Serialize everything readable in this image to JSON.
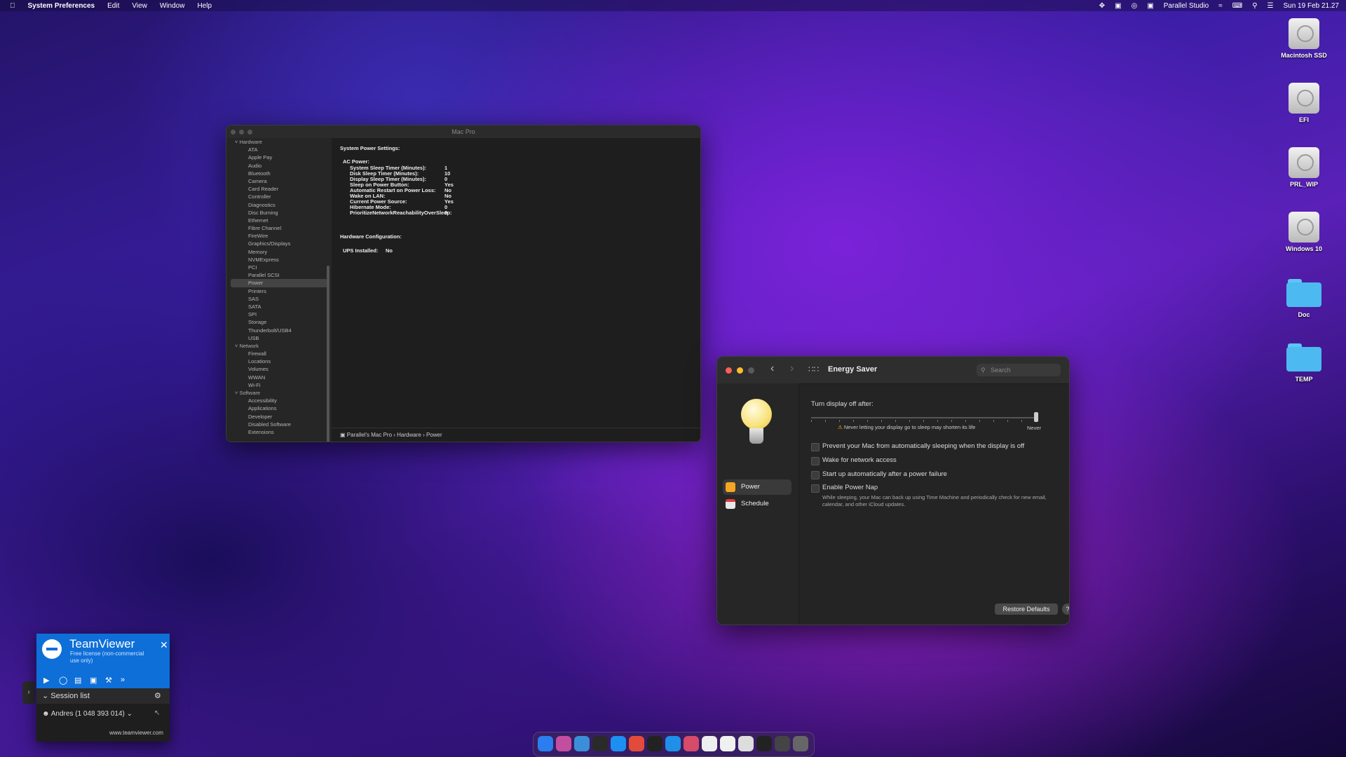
{
  "menubar": {
    "apple": "",
    "app": "System Preferences",
    "menus": [
      "Edit",
      "View",
      "Window",
      "Help"
    ],
    "user": "Parallel Studio",
    "datetime": "Sun 19 Feb  21.27"
  },
  "desktop": {
    "icons": [
      "Macintosh SSD",
      "EFI",
      "PRL_WIP",
      "Windows 10",
      "Doc",
      "TEMP"
    ]
  },
  "sysinfo": {
    "title": "Mac Pro",
    "sidebar": [
      {
        "kind": "cat",
        "label": "Hardware"
      },
      {
        "kind": "item",
        "label": "ATA"
      },
      {
        "kind": "item",
        "label": "Apple Pay"
      },
      {
        "kind": "item",
        "label": "Audio"
      },
      {
        "kind": "item",
        "label": "Bluetooth"
      },
      {
        "kind": "item",
        "label": "Camera"
      },
      {
        "kind": "item",
        "label": "Card Reader"
      },
      {
        "kind": "item",
        "label": "Controller"
      },
      {
        "kind": "item",
        "label": "Diagnostics"
      },
      {
        "kind": "item",
        "label": "Disc Burning"
      },
      {
        "kind": "item",
        "label": "Ethernet"
      },
      {
        "kind": "item",
        "label": "Fibre Channel"
      },
      {
        "kind": "item",
        "label": "FireWire"
      },
      {
        "kind": "item",
        "label": "Graphics/Displays"
      },
      {
        "kind": "item",
        "label": "Memory"
      },
      {
        "kind": "item",
        "label": "NVMExpress"
      },
      {
        "kind": "item",
        "label": "PCI"
      },
      {
        "kind": "item",
        "label": "Parallel SCSI"
      },
      {
        "kind": "item",
        "label": "Power",
        "selected": true
      },
      {
        "kind": "item",
        "label": "Printers"
      },
      {
        "kind": "item",
        "label": "SAS"
      },
      {
        "kind": "item",
        "label": "SATA"
      },
      {
        "kind": "item",
        "label": "SPI"
      },
      {
        "kind": "item",
        "label": "Storage"
      },
      {
        "kind": "item",
        "label": "Thunderbolt/USB4"
      },
      {
        "kind": "item",
        "label": "USB"
      },
      {
        "kind": "cat",
        "label": "Network"
      },
      {
        "kind": "item",
        "label": "Firewall"
      },
      {
        "kind": "item",
        "label": "Locations"
      },
      {
        "kind": "item",
        "label": "Volumes"
      },
      {
        "kind": "item",
        "label": "WWAN"
      },
      {
        "kind": "item",
        "label": "Wi-Fi"
      },
      {
        "kind": "cat",
        "label": "Software"
      },
      {
        "kind": "item",
        "label": "Accessibility"
      },
      {
        "kind": "item",
        "label": "Applications"
      },
      {
        "kind": "item",
        "label": "Developer"
      },
      {
        "kind": "item",
        "label": "Disabled Software"
      },
      {
        "kind": "item",
        "label": "Extensions"
      }
    ],
    "content": {
      "heading1": "System Power Settings:",
      "ac_label": "AC Power:",
      "rows": [
        {
          "k": "System Sleep Timer (Minutes):",
          "v": "1"
        },
        {
          "k": "Disk Sleep Timer (Minutes):",
          "v": "10"
        },
        {
          "k": "Display Sleep Timer (Minutes):",
          "v": "0"
        },
        {
          "k": "Sleep on Power Button:",
          "v": "Yes"
        },
        {
          "k": "Automatic Restart on Power Loss:",
          "v": "No"
        },
        {
          "k": "Wake on LAN:",
          "v": "No"
        },
        {
          "k": "Current Power Source:",
          "v": "Yes"
        },
        {
          "k": "Hibernate Mode:",
          "v": "0"
        },
        {
          "k": "PrioritizeNetworkReachabilityOverSleep:",
          "v": "0"
        }
      ],
      "heading2": "Hardware Configuration:",
      "ups_label": "UPS Installed:",
      "ups_value": "No"
    },
    "path": [
      "Parallel's Mac Pro",
      "Hardware",
      "Power"
    ]
  },
  "energy": {
    "title": "Energy Saver",
    "search_placeholder": "Search",
    "nav": [
      {
        "label": "Power",
        "selected": true,
        "color": "#f5a623"
      },
      {
        "label": "Schedule",
        "selected": false,
        "color": "#e8e8e8"
      }
    ],
    "display_off_label": "Turn display off after:",
    "slider_value": "Never",
    "warning": "Never letting your display go to sleep may shorten its life",
    "options": [
      {
        "label": "Prevent your Mac from automatically sleeping when the display is off",
        "checked": false
      },
      {
        "label": "Wake for network access",
        "checked": false
      },
      {
        "label": "Start up automatically after a power failure",
        "checked": false
      },
      {
        "label": "Enable Power Nap",
        "checked": false
      }
    ],
    "powernap_desc": "While sleeping, your Mac can back up using Time Machine and periodically check for new email, calendar, and other iCloud updates.",
    "restore_label": "Restore Defaults",
    "help_label": "?"
  },
  "teamviewer": {
    "name": "TeamViewer",
    "license": "Free license (non-commercial use only)",
    "session_label": "Session list",
    "user": "Andres (1 048 393 014)",
    "url": "www.teamviewer.com"
  },
  "dock": {
    "colors": [
      "#2a7ef0",
      "#c34ea0",
      "#3a8fd8",
      "#2a2a2a",
      "#1d8ff0",
      "#e24b3a",
      "#222",
      "#1f8fe8",
      "#d64a6a",
      "#eee",
      "#f0f0f0",
      "#ddd",
      "#222",
      "#444",
      "#666"
    ]
  }
}
